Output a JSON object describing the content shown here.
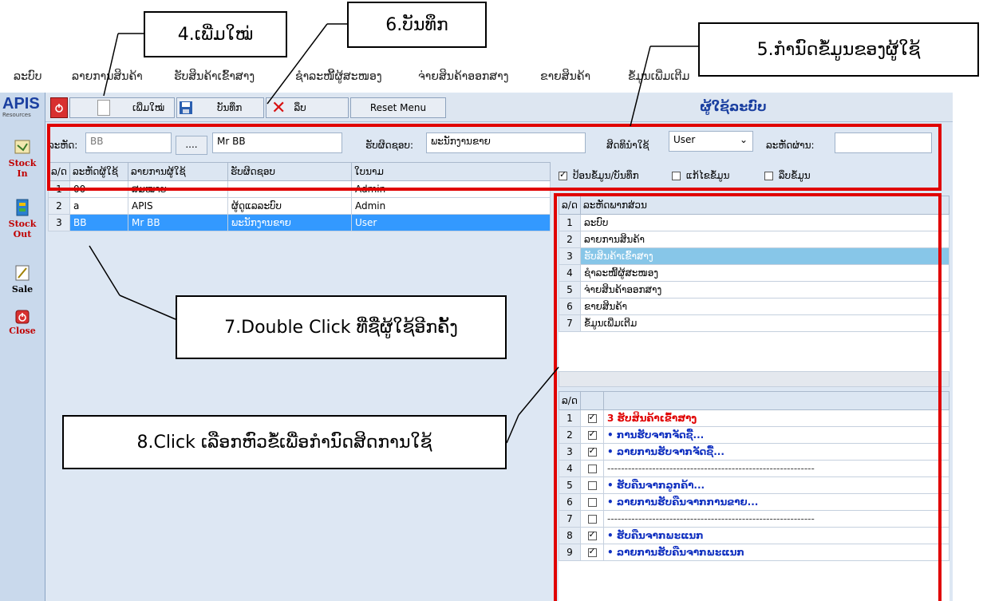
{
  "callouts": {
    "add_new": "4.ເພີ່ມໃໝ່",
    "save": "6.ບັນທຶກ",
    "set_user_info": "5.ກຳນົດຂໍ້ມູນຂອງຜູ້ໃຊ້",
    "double_click": "7.Double Click  ທີ່ຊື່ຜູ້ໃຊ້ອີກຄັ້ງ",
    "click_select": "8.Click  ເລືອກຫົວຂໍ້ເພື່ອກຳນົດສິດການໃຊ້"
  },
  "menu": [
    "ລະບົບ",
    "ລາຍການສິນຄ້າ",
    "ຮັບສິນຄ້າເຂົ້າສາງ",
    "ຊຳລະໜີ້ຜູ້ສະໜອງ",
    "ຈ່າຍສິນຄ້າອອກສາງ",
    "ຂາຍສິນຄ້າ",
    "ຂໍ້ມູນເພີ່ມເຕີມ"
  ],
  "logo": {
    "text": "APIS",
    "sub": "Resources"
  },
  "dock": [
    {
      "label": "Stock In",
      "icon": "stock-in-icon"
    },
    {
      "label": "Stock Out",
      "icon": "stock-out-icon"
    },
    {
      "label": "Sale",
      "icon": "sale-icon"
    },
    {
      "label": "Close",
      "icon": "close-icon"
    }
  ],
  "toolbar": {
    "add_label": "ເພີ່ມໃໝ່",
    "save_label": "ບັນທຶກ",
    "delete_label": "ລຶບ",
    "reset_label": "Reset Menu",
    "window_title": "ຜູ້ໃຊ້ລະບົບ"
  },
  "form": {
    "code_label": "ລະຫັດ:",
    "code_value": "BB",
    "browse_label": "....",
    "name_value": "Mr BB",
    "position_label": "ຮັບຜິດຊອບ:",
    "position_value": "ພະນັກງານຂາຍ",
    "permission_label": "ສິດທິນຳໃຊ້",
    "permission_value": "User",
    "password_label": "ລະຫັດຜ່ານ:",
    "password_value": "",
    "chk_input_label": "ປ້ອນຂໍ້ມູນ/ບັນທຶກ",
    "chk_input_checked": true,
    "chk_edit_label": "ແກ້ໄຂຂໍ້ມູນ",
    "chk_edit_checked": false,
    "chk_delete_label": "ລຶບຂໍ້ມູນ",
    "chk_delete_checked": false
  },
  "users_table": {
    "headers": [
      "ລ/ດ",
      "ລະຫັດຜູ້ໃຊ້",
      "ລາຍການຜູ້ໃຊ້",
      "ຮັບຜິດຊອບ",
      "ໃບນາມ"
    ],
    "rows": [
      [
        "1",
        "00",
        "ສມໝາຍ",
        "",
        "Admin"
      ],
      [
        "2",
        "a",
        "APIS",
        "ຜູ້ດູແລລະບົບ",
        "Admin"
      ],
      [
        "3",
        "BB",
        "Mr BB",
        "ພະນັກງານຂາຍ",
        "User"
      ]
    ],
    "selected_row": 3
  },
  "modules_table": {
    "headers": [
      "ລ/ດ",
      "ລະຫັດພາກສ່ວນ"
    ],
    "rows": [
      [
        "1",
        "ລະບົບ"
      ],
      [
        "2",
        "ລາຍການສິນຄ້າ"
      ],
      [
        "3",
        "ຮັບສິນຄ້າເຂົ້າສາງ"
      ],
      [
        "4",
        "ຊຳລະໜີ້ຜູ້ສະໜອງ"
      ],
      [
        "5",
        "ຈ່າຍສິນຄ້າອອກສາງ"
      ],
      [
        "6",
        "ຂາຍສິນຄ້າ"
      ],
      [
        "7",
        "ຂໍ້ມູນເພີ່ມເຕີມ"
      ]
    ],
    "selected_row": 3
  },
  "rights_table": {
    "headers": [
      "ລ/ດ",
      "",
      ""
    ],
    "rows": [
      {
        "no": "1",
        "checked": true,
        "text": "3  ຮັບສິນຄ້າເຂົ້າສາງ",
        "style": "heading"
      },
      {
        "no": "2",
        "checked": true,
        "text": "•   ການຮັບຈາກຈັດຊື້...",
        "style": "item"
      },
      {
        "no": "3",
        "checked": true,
        "text": "•   ລາຍການຮັບຈາກຈັດຊື້...",
        "style": "item"
      },
      {
        "no": "4",
        "checked": false,
        "text": "------------------------------------------------------------",
        "style": "sep"
      },
      {
        "no": "5",
        "checked": false,
        "text": "•   ຮັບຄືນຈາກລູກຄ້າ...",
        "style": "item"
      },
      {
        "no": "6",
        "checked": false,
        "text": "•   ລາຍການຮັບຄືນຈາກການຂາຍ...",
        "style": "item"
      },
      {
        "no": "7",
        "checked": false,
        "text": "------------------------------------------------------------",
        "style": "sep"
      },
      {
        "no": "8",
        "checked": true,
        "text": "•   ຮັບຄືນຈາກພະແນກ",
        "style": "item"
      },
      {
        "no": "9",
        "checked": true,
        "text": "•   ລາຍການຮັບຄືນຈາກພະແນກ",
        "style": "item"
      }
    ]
  },
  "colors": {
    "selection": "#3399ff",
    "module_selection": "#87c6e8",
    "highlight_red": "#e00000",
    "link_blue": "#1030c0"
  }
}
